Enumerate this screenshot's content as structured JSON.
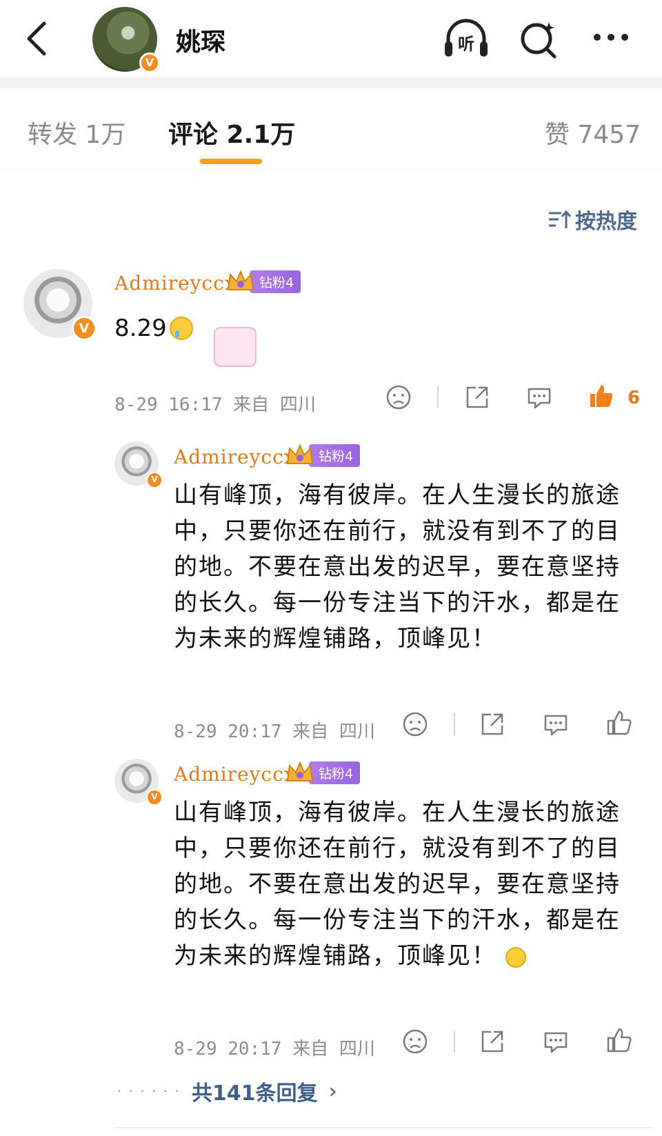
{
  "header": {
    "title": "姚琛",
    "avatar_badge": "V",
    "icons": [
      "back-icon",
      "listen-icon",
      "search-icon",
      "more-icon"
    ],
    "listen_label": "听"
  },
  "tabs": {
    "forward": "转发 1万",
    "comment": "评论 2.1万",
    "like": "赞 7457",
    "active_color": "#f6a11c"
  },
  "sort_label": "按热度",
  "comments": [
    {
      "username": "Admireyccx",
      "badge": "钻粉4",
      "text": "8.29",
      "time": "8-29 16:17 来自 四川",
      "likes": "6"
    }
  ],
  "replies": [
    {
      "username": "Admireyccx",
      "badge": "钻粉4",
      "text": "山有峰顶，海有彼岸。在人生漫长的旅途中，只要你还在前行，就没有到不了的目的地。不要在意出发的迟早，要在意坚持的长久。每一份专注当下的汗水，都是在为未来的辉煌铺路，顶峰见！",
      "time": "8-29 20:17 来自 四川"
    },
    {
      "username": "Admireyccx",
      "badge": "钻粉4",
      "text": "山有峰顶，海有彼岸。在人生漫长的旅途中，只要你还在前行，就没有到不了的目的地。不要在意出发的迟早，要在意坚持的长久。每一份专注当下的汗水，都是在为未来的辉煌铺路，顶峰见！",
      "time": "8-29 20:17 来自 四川"
    }
  ],
  "more_replies": "共141条回复",
  "colors": {
    "username": "#e27a1a",
    "link": "#3f5f88",
    "like_active": "#f0821e"
  }
}
